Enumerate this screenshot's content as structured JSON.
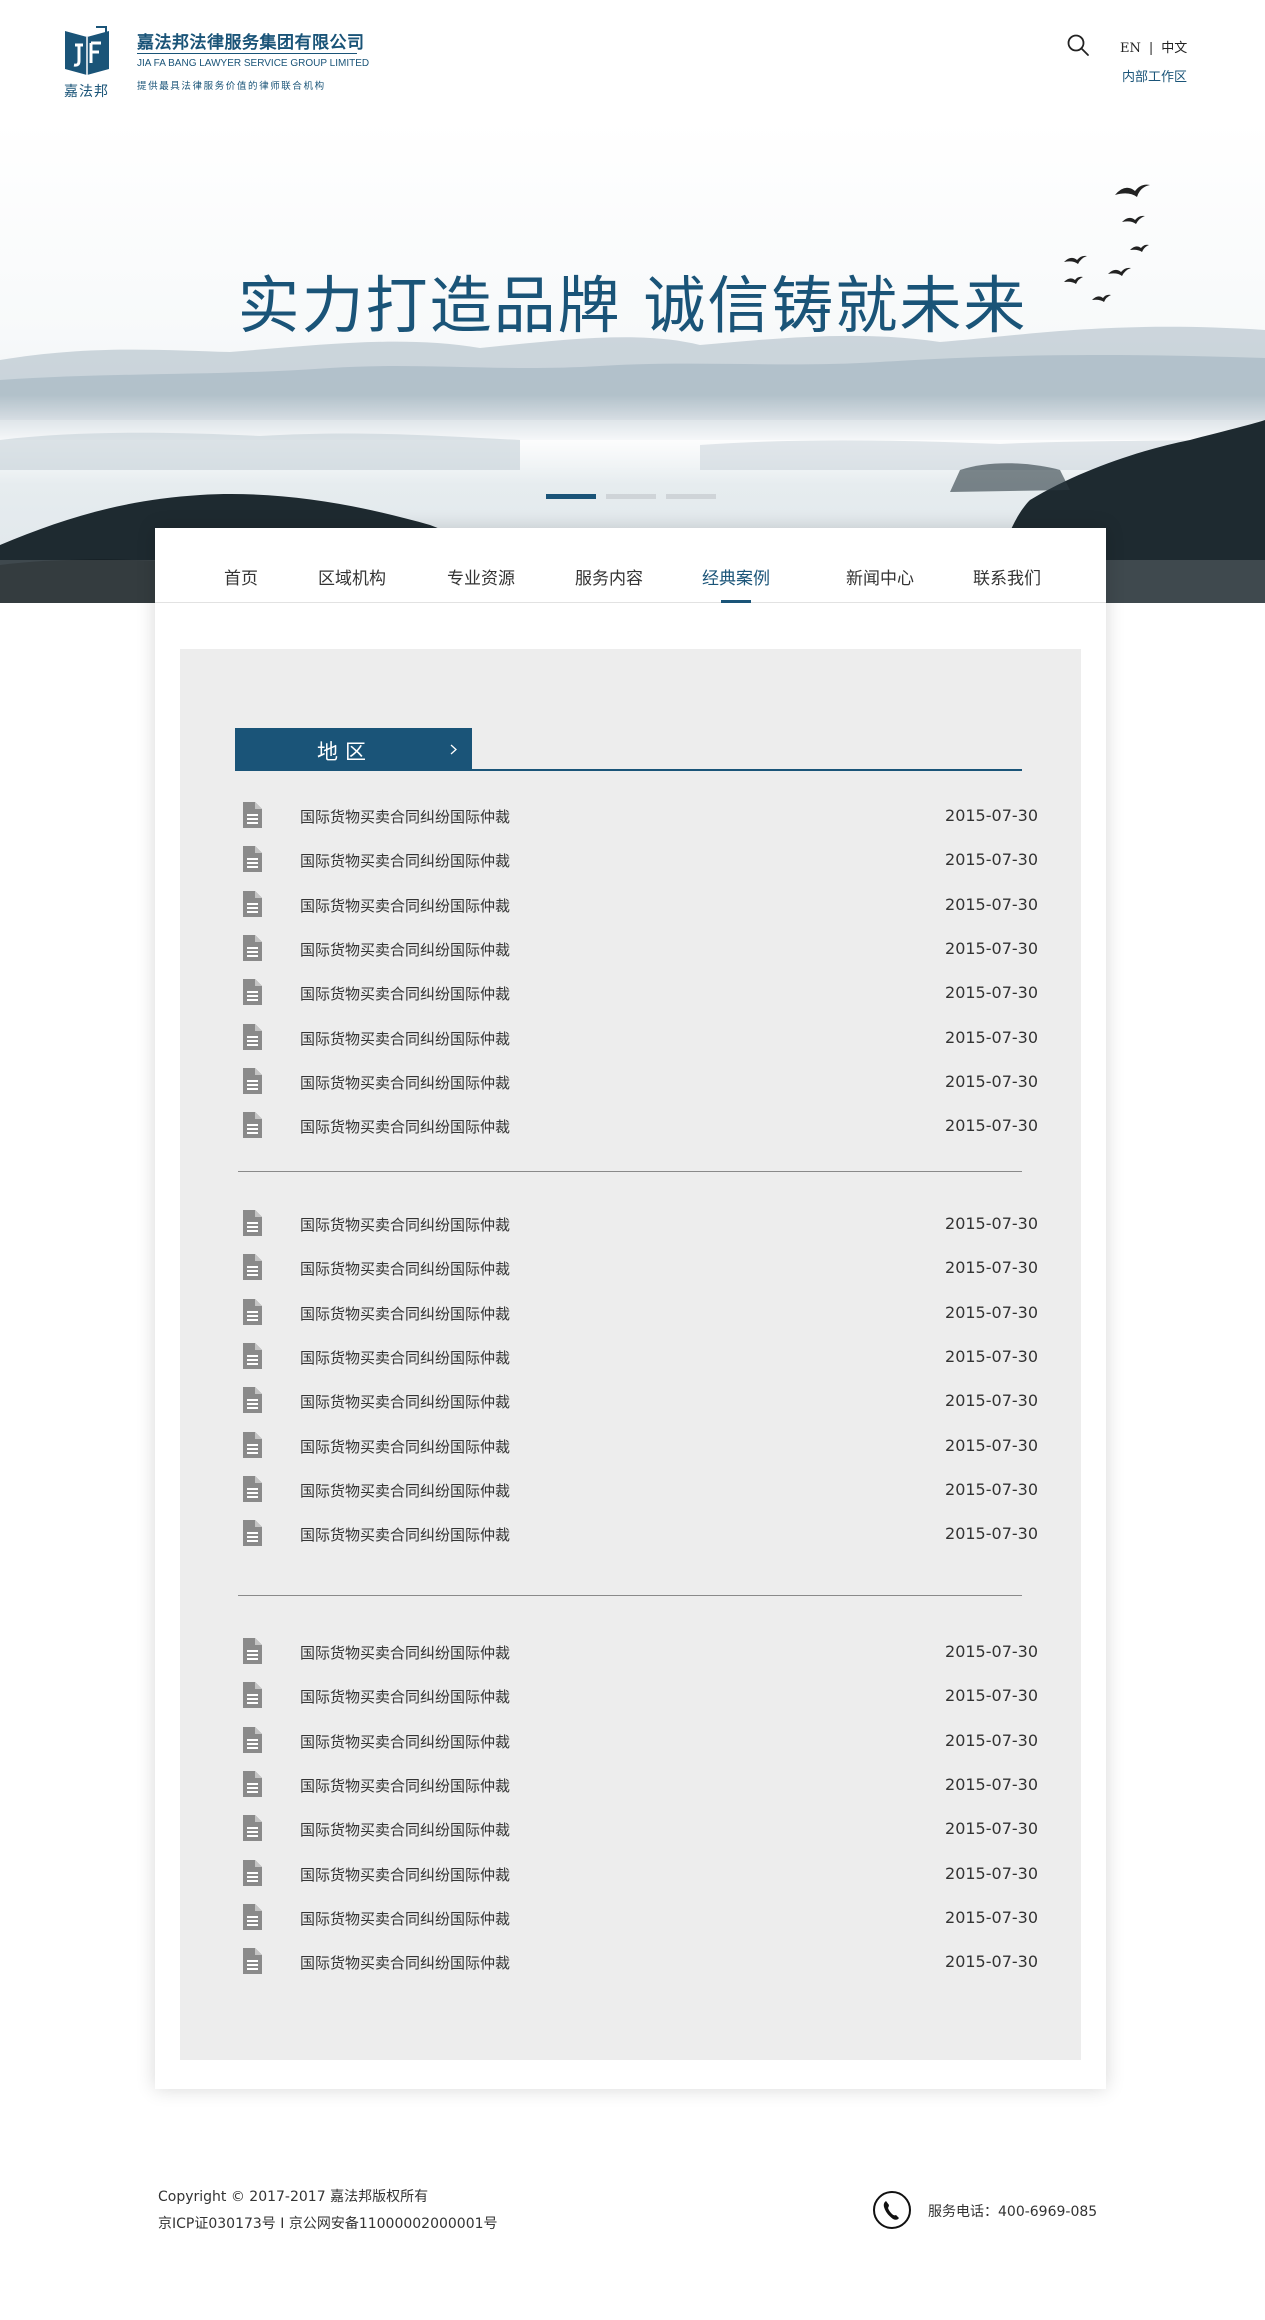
{
  "header": {
    "logo_under": "嘉法邦",
    "company_name_cn": "嘉法邦法律服务集团有限公司",
    "company_name_en": "JIA FA BANG LAWYER SERVICE GROUP LIMITED",
    "slogan": "提供最具法律服务价值的律师联合机构",
    "search_icon": "search-icon",
    "lang_en": "EN",
    "lang_sep": "|",
    "lang_cn": "中文",
    "work_area": "内部工作区"
  },
  "banner": {
    "slogan": "实力打造品牌  诚信铸就未来",
    "slides_total": 3,
    "active_slide": 1
  },
  "nav": {
    "items": [
      {
        "label": "首页"
      },
      {
        "label": "区域机构"
      },
      {
        "label": "专业资源"
      },
      {
        "label": "服务内容"
      },
      {
        "label": "经典案例"
      },
      {
        "label": "新闻中心"
      },
      {
        "label": "联系我们"
      }
    ],
    "active_label": "经典案例"
  },
  "section": {
    "tab_label": "地区",
    "tab_icon": "chevron-right-icon"
  },
  "case_groups": [
    {
      "items": [
        {
          "title": "国际货物买卖合同纠纷国际仲裁",
          "date": "2015-07-30"
        },
        {
          "title": "国际货物买卖合同纠纷国际仲裁",
          "date": "2015-07-30"
        },
        {
          "title": "国际货物买卖合同纠纷国际仲裁",
          "date": "2015-07-30"
        },
        {
          "title": "国际货物买卖合同纠纷国际仲裁",
          "date": "2015-07-30"
        },
        {
          "title": "国际货物买卖合同纠纷国际仲裁",
          "date": "2015-07-30"
        },
        {
          "title": "国际货物买卖合同纠纷国际仲裁",
          "date": "2015-07-30"
        },
        {
          "title": "国际货物买卖合同纠纷国际仲裁",
          "date": "2015-07-30"
        },
        {
          "title": "国际货物买卖合同纠纷国际仲裁",
          "date": "2015-07-30"
        }
      ]
    },
    {
      "items": [
        {
          "title": "国际货物买卖合同纠纷国际仲裁",
          "date": "2015-07-30"
        },
        {
          "title": "国际货物买卖合同纠纷国际仲裁",
          "date": "2015-07-30"
        },
        {
          "title": "国际货物买卖合同纠纷国际仲裁",
          "date": "2015-07-30"
        },
        {
          "title": "国际货物买卖合同纠纷国际仲裁",
          "date": "2015-07-30"
        },
        {
          "title": "国际货物买卖合同纠纷国际仲裁",
          "date": "2015-07-30"
        },
        {
          "title": "国际货物买卖合同纠纷国际仲裁",
          "date": "2015-07-30"
        },
        {
          "title": "国际货物买卖合同纠纷国际仲裁",
          "date": "2015-07-30"
        },
        {
          "title": "国际货物买卖合同纠纷国际仲裁",
          "date": "2015-07-30"
        }
      ]
    },
    {
      "items": [
        {
          "title": "国际货物买卖合同纠纷国际仲裁",
          "date": "2015-07-30"
        },
        {
          "title": "国际货物买卖合同纠纷国际仲裁",
          "date": "2015-07-30"
        },
        {
          "title": "国际货物买卖合同纠纷国际仲裁",
          "date": "2015-07-30"
        },
        {
          "title": "国际货物买卖合同纠纷国际仲裁",
          "date": "2015-07-30"
        },
        {
          "title": "国际货物买卖合同纠纷国际仲裁",
          "date": "2015-07-30"
        },
        {
          "title": "国际货物买卖合同纠纷国际仲裁",
          "date": "2015-07-30"
        },
        {
          "title": "国际货物买卖合同纠纷国际仲裁",
          "date": "2015-07-30"
        },
        {
          "title": "国际货物买卖合同纠纷国际仲裁",
          "date": "2015-07-30"
        }
      ]
    }
  ],
  "footer": {
    "copyright": "Copyright © 2017-2017 嘉法邦版权所有",
    "icp": "京ICP证030173号 I 京公网安备11000002000001号",
    "phone_icon": "phone-icon",
    "service_phone": "服务电话：400-6969-085"
  },
  "colors": {
    "brand": "#1a5478",
    "panel_bg": "#ededed",
    "doc_icon": "#8a8a8a"
  }
}
